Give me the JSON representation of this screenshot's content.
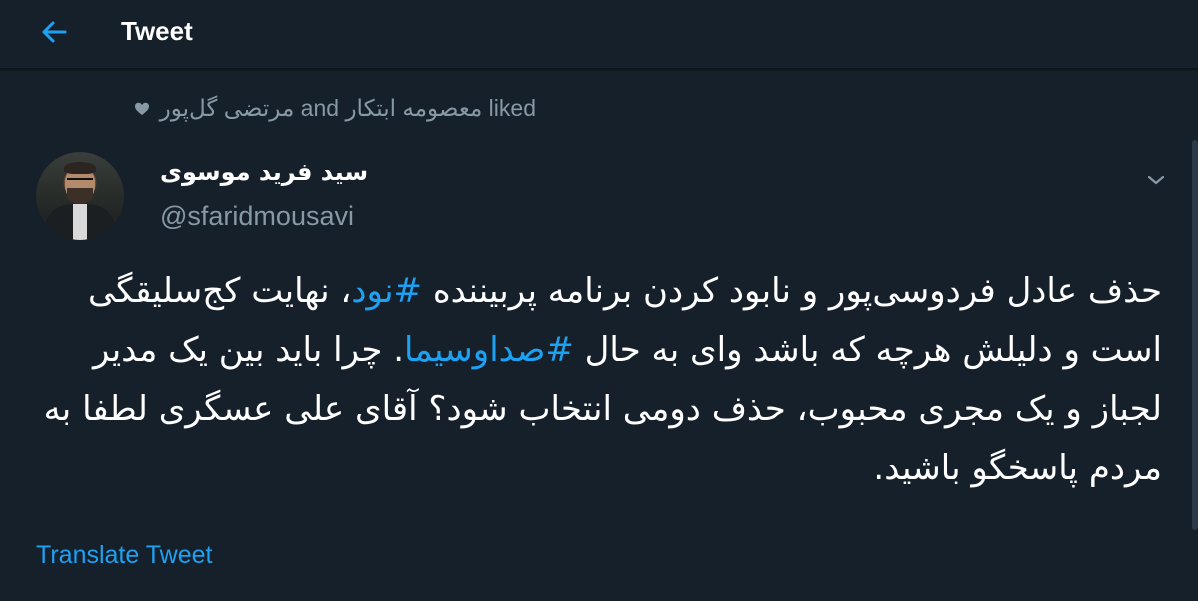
{
  "header": {
    "title": "Tweet",
    "back_icon": "arrow-left-icon"
  },
  "social_context": {
    "icon": "heart-icon",
    "text": "مرتضی گل‌پور and معصومه ابتکار liked"
  },
  "tweet": {
    "author": {
      "display_name": "سید فرید موسوی",
      "handle": "@sfaridmousavi"
    },
    "text": {
      "line1_a": "حذف عادل فردوسی‌پور و نابود کردن برنامه پربیننده ",
      "hashtag1": "#نود",
      "line1_b": "، نهایت کج‌سلیقگی است و دلیلش هرچه که باشد وای به حال ",
      "hashtag2": "#صداوسیما",
      "line1_c": ".",
      "rest": " چرا باید بین یک مدیر لجباز و یک مجری محبوب، حذف دومی انتخاب شود؟ آقای علی عسگری لطفا به مردم پاسخگو باشید."
    },
    "translate_label": "Translate Tweet"
  },
  "colors": {
    "background": "#15202b",
    "accent": "#1da1f2",
    "secondary_text": "#8899a6"
  }
}
